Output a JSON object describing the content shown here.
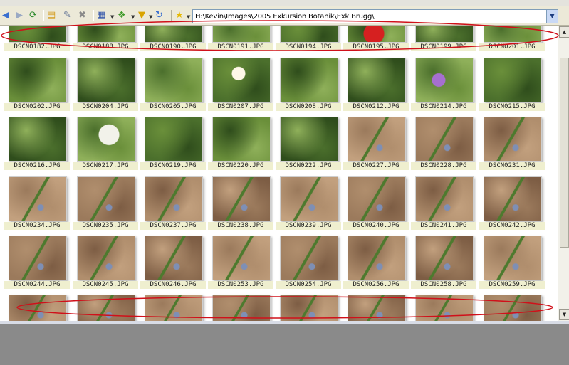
{
  "toolbar": {
    "back_icon": "back-arrow-icon",
    "forward_icon": "forward-arrow-icon",
    "up_icon": "up-folder-icon",
    "address": "H:\\Kevin\\Images\\2005 Exkursion Botanik\\Exk Brugg\\",
    "colors": {
      "toolbar_bg": "#ece9d8",
      "address_border": "#7f9db9"
    }
  },
  "grid": {
    "rows": [
      [
        "DSCN0182.JPG",
        "DSCN0188.JPG",
        "DSCN0190.JPG",
        "DSCN0191.JPG",
        "DSCN0194.JPG",
        "DSCN0195.JPG",
        "DSCN0199.JPG",
        "DSCN0201.JPG"
      ],
      [
        "DSCN0202.JPG",
        "DSCN0204.JPG",
        "DSCN0205.JPG",
        "DSCN0207.JPG",
        "DSCN0208.JPG",
        "DSCN0212.JPG",
        "DSCN0214.JPG",
        "DSCN0215.JPG"
      ],
      [
        "DSCN0216.JPG",
        "DSCN0217.JPG",
        "DSCN0219.JPG",
        "DSCN0220.JPG",
        "DSCN0222.JPG",
        "DSCN0227.JPG",
        "DSCN0228.JPG",
        "DSCN0231.JPG"
      ],
      [
        "DSCN0234.JPG",
        "DSCN0235.JPG",
        "DSCN0237.JPG",
        "DSCN0238.JPG",
        "DSCN0239.JPG",
        "DSCN0240.JPG",
        "DSCN0241.JPG",
        "DSCN0242.JPG"
      ],
      [
        "DSCN0244.JPG",
        "DSCN0245.JPG",
        "DSCN0246.JPG",
        "DSCN0253.JPG",
        "DSCN0254.JPG",
        "DSCN0256.JPG",
        "DSCN0258.JPG",
        "DSCN0259.JPG"
      ],
      [
        "",
        "",
        "",
        "",
        "",
        "",
        "",
        ""
      ]
    ]
  },
  "colors": {
    "caption_bg": "#efefcf",
    "annotation_red": "#d0101a",
    "taskbar_gray": "#8a8a8a"
  }
}
